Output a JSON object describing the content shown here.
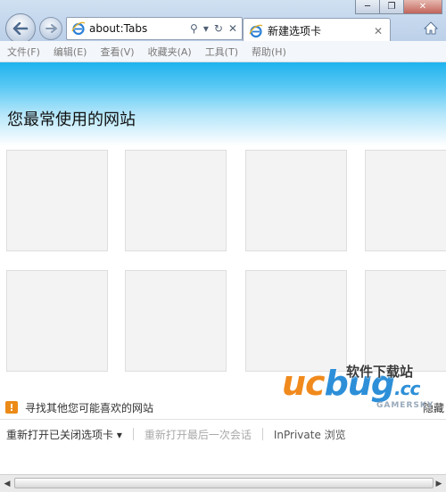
{
  "window": {
    "minimize_glyph": "─",
    "restore_glyph": "❐",
    "close_glyph": "✕"
  },
  "navigation": {
    "back_icon": "back-arrow-icon",
    "forward_icon": "forward-arrow-icon"
  },
  "address_bar": {
    "url": "about:Tabs",
    "search_glyph": "⚲",
    "dropdown_glyph": "▾",
    "refresh_glyph": "↻",
    "stop_glyph": "✕"
  },
  "tab": {
    "label": "新建选项卡",
    "close_glyph": "✕"
  },
  "menu": {
    "items": [
      {
        "label": "文件(F)"
      },
      {
        "label": "编辑(E)"
      },
      {
        "label": "查看(V)"
      },
      {
        "label": "收藏夹(A)"
      },
      {
        "label": "工具(T)"
      },
      {
        "label": "帮助(H)"
      }
    ]
  },
  "page": {
    "title": "您最常使用的网站",
    "suggest_label": "寻找其他您可能喜欢的网站",
    "hide_link": "隐藏",
    "reopen_closed_tabs": "重新打开已关闭选项卡 ▾",
    "reopen_last_session": "重新打开最后一次会话",
    "inprivate": "InPrivate 浏览",
    "accent": "#1fb3ee"
  },
  "watermark": {
    "logo_uc": "uc",
    "logo_bug": "bug",
    "logo_cc": ".cc",
    "cn_text": "软件下载站",
    "site": "GAMERSKY"
  },
  "scrollbar": {
    "left_glyph": "◀",
    "right_glyph": "▶"
  }
}
